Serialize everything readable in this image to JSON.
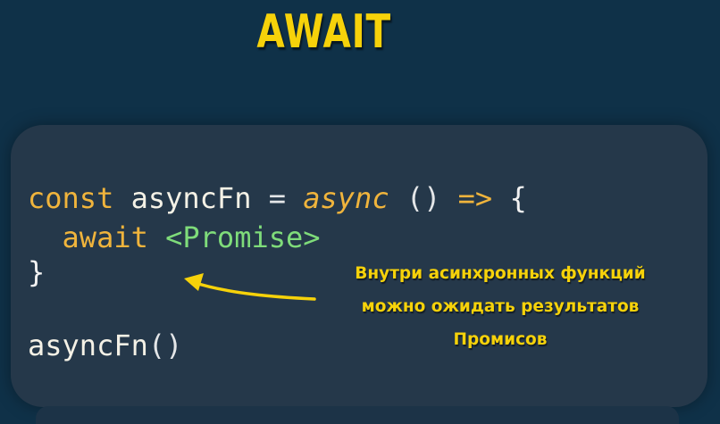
{
  "slide": {
    "title": "AWAIT",
    "accent_color": "#f6d20a",
    "background_color": "#0f3148",
    "panel_color": "#25384a"
  },
  "code": {
    "line1": {
      "kw": "const",
      "name": "asyncFn",
      "eq": "=",
      "async": "async",
      "parens": "()",
      "arrow": "=>",
      "brace": "{"
    },
    "line2": {
      "await": "await",
      "promise": "<Promise>"
    },
    "line3": {
      "brace": "}"
    },
    "line4": {
      "name": "asyncFn",
      "parens": "()"
    }
  },
  "annotation": {
    "text": "Внутри асинхронных функций\nможно ожидать результатов\nПромисов",
    "arrow_icon": "curved-arrow-left-icon"
  }
}
